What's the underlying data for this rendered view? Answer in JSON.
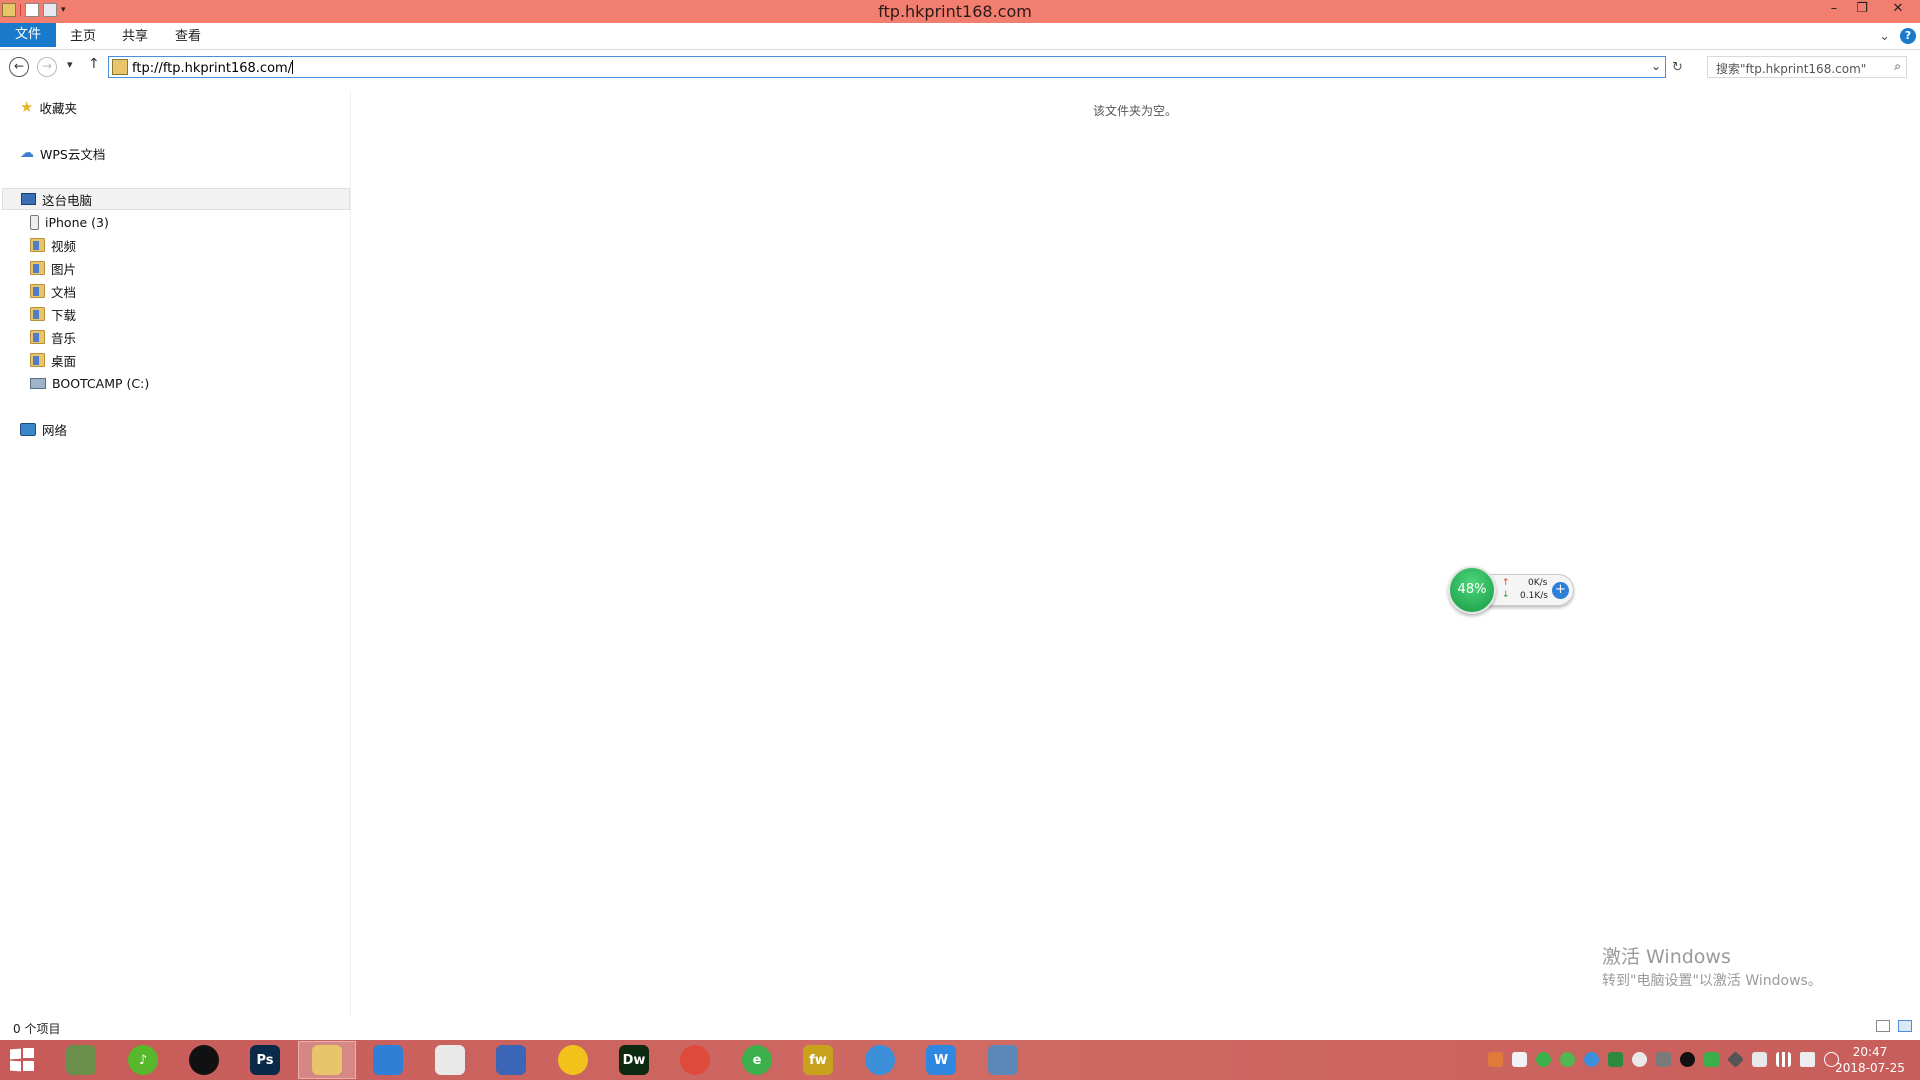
{
  "window": {
    "title": "ftp.hkprint168.com",
    "controls": {
      "minimize": "–",
      "restore": "❐",
      "close": "✕"
    }
  },
  "ribbon": {
    "tabs": [
      "文件",
      "主页",
      "共享",
      "查看"
    ],
    "help": "?",
    "expand": "⌄"
  },
  "nav": {
    "back": "←",
    "forward": "→",
    "recent": "▾",
    "up": "↑",
    "address": "ftp://ftp.hkprint168.com/",
    "address_dropdown": "⌄",
    "refresh": "↻",
    "search_placeholder": "搜索\"ftp.hkprint168.com\"",
    "search_icon": "⌕"
  },
  "sidebar": {
    "favorites": "收藏夹",
    "wps": "WPS云文档",
    "this_pc": "这台电脑",
    "items": [
      {
        "label": "iPhone (3)",
        "icon": "phone-icon"
      },
      {
        "label": "视频",
        "icon": "folder-icon"
      },
      {
        "label": "图片",
        "icon": "folder-icon"
      },
      {
        "label": "文档",
        "icon": "folder-icon"
      },
      {
        "label": "下载",
        "icon": "folder-icon"
      },
      {
        "label": "音乐",
        "icon": "folder-icon"
      },
      {
        "label": "桌面",
        "icon": "folder-icon"
      },
      {
        "label": "BOOTCAMP (C:)",
        "icon": "drive-icon"
      }
    ],
    "network": "网络"
  },
  "content": {
    "empty_message": "该文件夹为空。"
  },
  "widget": {
    "percent": "48%",
    "upload": "0K/s",
    "download": "0.1K/s",
    "up_arrow": "↑",
    "down_arrow": "↓",
    "plus": "+"
  },
  "watermark": {
    "line1": "激活 Windows",
    "line2": "转到\"电脑设置\"以激活 Windows。"
  },
  "status": {
    "count": "0 个项目"
  },
  "taskbar": {
    "apps": [
      {
        "name": "tools-app",
        "label": "",
        "color": "#6a8f4a"
      },
      {
        "name": "itunes-app",
        "label": "♪",
        "color": "#58b82c"
      },
      {
        "name": "qq-app",
        "label": "",
        "color": "#111111"
      },
      {
        "name": "photoshop-app",
        "label": "Ps",
        "color": "#0b2a4a"
      },
      {
        "name": "file-explorer-app",
        "label": "",
        "color": "#e8c56b"
      },
      {
        "name": "photos-app",
        "label": "",
        "color": "#2f7fd6"
      },
      {
        "name": "wechat-app",
        "label": "",
        "color": "#e9e9e9"
      },
      {
        "name": "remote-desktop-app",
        "label": "",
        "color": "#3b66b5"
      },
      {
        "name": "qqmusic-app",
        "label": "",
        "color": "#f2c11a"
      },
      {
        "name": "dreamweaver-app",
        "label": "Dw",
        "color": "#0c2a10"
      },
      {
        "name": "chrome-app",
        "label": "",
        "color": "#de4a3b"
      },
      {
        "name": "ie-app",
        "label": "e",
        "color": "#3bb04a"
      },
      {
        "name": "fireworks-app",
        "label": "fw",
        "color": "#c8a21c"
      },
      {
        "name": "browser-app",
        "label": "",
        "color": "#3e8fd9"
      },
      {
        "name": "wps-app",
        "label": "W",
        "color": "#2f87e0"
      },
      {
        "name": "screen-app",
        "label": "",
        "color": "#5c88b8"
      }
    ],
    "time": "20:47",
    "date": "2018-07-25"
  }
}
